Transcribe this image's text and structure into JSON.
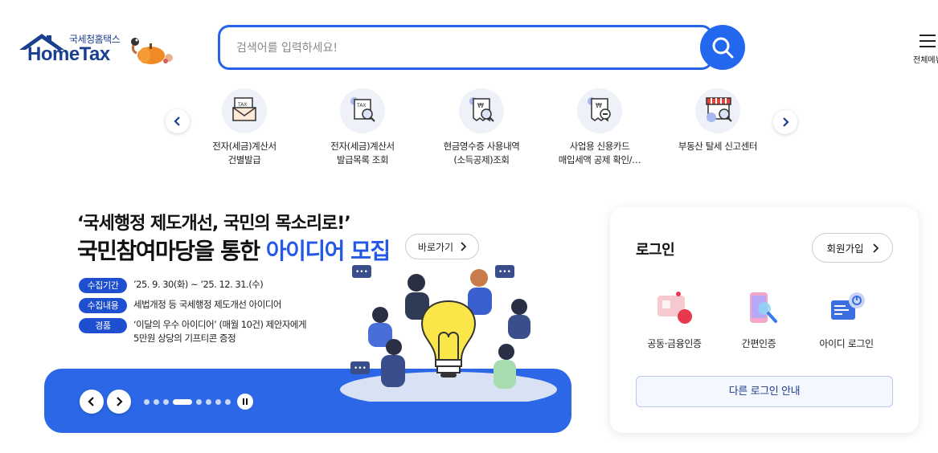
{
  "header": {
    "logo_sub": "국세청홈택스",
    "logo_main": "HomeTax",
    "search_placeholder": "검색어를 입력하세요!",
    "menu_label": "전체메뉴"
  },
  "quick_menu": {
    "items": [
      {
        "label_line1": "전자(세금)계산서",
        "label_line2": "건별발급",
        "icon": "tax-envelope-icon"
      },
      {
        "label_line1": "전자(세금)계산서",
        "label_line2": "발급목록 조회",
        "icon": "tax-search-icon"
      },
      {
        "label_line1": "현금영수증 사용내역",
        "label_line2": "(소득공제)조회",
        "icon": "receipt-search-icon"
      },
      {
        "label_line1": "사업용 신용카드",
        "label_line2": "매입세액 공제 확인/…",
        "icon": "card-receipt-icon"
      },
      {
        "label_line1": "부동산 탈세 신고센터",
        "label_line2": "",
        "icon": "store-search-icon"
      }
    ]
  },
  "banner": {
    "title_line1": "‘국세행정 제도개선, 국민의 목소리로!’",
    "title_line2_prefix": "국민참여마당을 통한 ",
    "title_line2_highlight": "아이디어 모집",
    "goto_label": "바로가기",
    "info": [
      {
        "pill": "수집기간",
        "text": "’25. 9. 30(화) ~ ’25. 12. 31.(수)"
      },
      {
        "pill": "수집내용",
        "text": "세법개정 등 국세행정 제도개선 아이디어"
      },
      {
        "pill": "경품",
        "text_line1": "‘이달의 우수 아이디어’ (매월 10건) 제안자에게",
        "text_line2": "5만원 상당의 기프티콘 증정"
      }
    ],
    "slide_count": 9,
    "active_slide": 4
  },
  "login": {
    "title": "로그인",
    "signup_label": "회원가입",
    "options": [
      {
        "label": "공동·금융인증",
        "icon": "certificate-icon"
      },
      {
        "label": "간편인증",
        "icon": "phone-auth-icon"
      },
      {
        "label": "아이디 로그인",
        "icon": "id-login-icon"
      }
    ],
    "other_login_label": "다른 로그인 안내"
  },
  "colors": {
    "primary": "#2467ef",
    "brand_navy": "#1b3f8f",
    "banner_bar": "#2b67e6",
    "pill": "#1e4fd0"
  }
}
